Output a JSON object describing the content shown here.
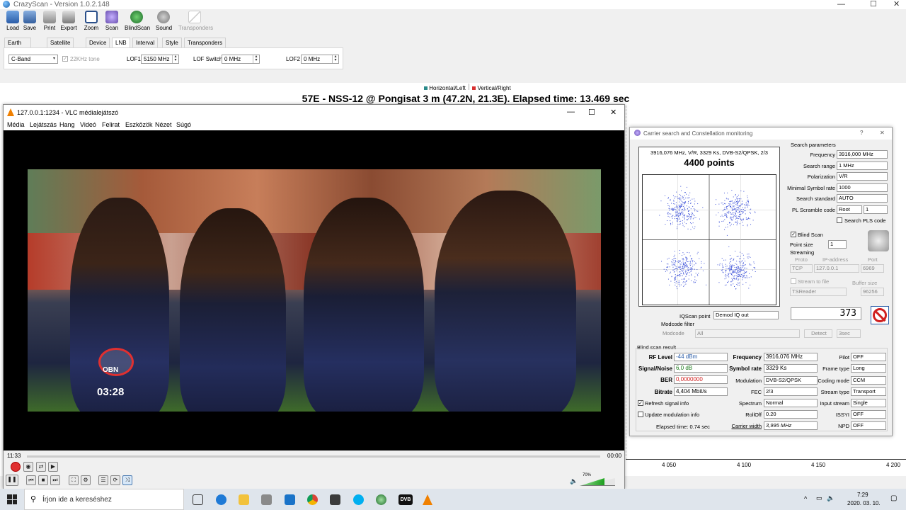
{
  "app": {
    "title": "CrazyScan - Version 1.0.2.148",
    "window_controls": {
      "minimize": "—",
      "maximize": "☐",
      "close": "✕"
    }
  },
  "toolbar": [
    {
      "label": "Load",
      "icon": "load-icon"
    },
    {
      "label": "Save",
      "icon": "save-icon"
    },
    {
      "label": "Print",
      "icon": "print-icon"
    },
    {
      "label": "Export",
      "icon": "export-icon"
    },
    {
      "label": "Zoom",
      "icon": "zoom-icon"
    },
    {
      "label": "Scan",
      "icon": "scan-icon"
    },
    {
      "label": "BlindScan",
      "icon": "blindscan-icon"
    },
    {
      "label": "Sound",
      "icon": "sound-icon"
    },
    {
      "label": "Transponders",
      "icon": "transponders-icon"
    }
  ],
  "tabs": [
    "Earth position",
    "Satellite info",
    "Device",
    "LNB",
    "Interval",
    "Style",
    "Transponders"
  ],
  "lnb": {
    "band": "C-Band",
    "tone_label": "22KHz tone",
    "lof1_label": "LOF1",
    "lof1": "5150 MHz",
    "lofswitch_label": "LOF Switch",
    "lofswitch": "0 MHz",
    "lof2_label": "LOF2",
    "lof2": "0 MHz"
  },
  "legend": {
    "h": "Horizontal/Left",
    "v": "Vertical/Right",
    "h_color": "#2a8a8a",
    "v_color": "#d83030"
  },
  "chart_title": "57E - NSS-12  @ Pongisat  3 m (47.2N, 21.3E). Elapsed time: 13.469 sec",
  "x_ticks": [
    "4 050",
    "4 100",
    "4 150",
    "4 200"
  ],
  "vlc": {
    "title": "127.0.0.1:1234 - VLC médialejátszó",
    "menu": [
      "Média",
      "Lejátszás",
      "Hang",
      "Videó",
      "Felirat",
      "Eszközök",
      "Nézet",
      "Súgó"
    ],
    "overlay_time": "03:28",
    "overlay_logo": "OBN",
    "time_elapsed": "11:33",
    "time_total": "00:00",
    "volume": "70%",
    "volume_fraction": 0.7
  },
  "dialog": {
    "title": "Carrier search and Constellation monitoring",
    "help": "?",
    "close": "✕",
    "constellation_info": "3916,076 MHz, V/R, 3329 Ks, DVB-S2/QPSK, 2/3",
    "points": "4400 points",
    "search_params_title": "Search parameters",
    "params": {
      "frequency_label": "Frequency",
      "frequency": "3916,000 MHz",
      "search_range_label": "Search range",
      "search_range": "1 MHz",
      "polarization_label": "Polarization",
      "polarization": "V/R",
      "min_sr_label": "Minimal Symbol rate",
      "min_sr": "1000",
      "search_std_label": "Search standard",
      "search_std": "AUTO",
      "pls_label": "PL Scramble code",
      "pls_mode": "Root",
      "pls_value": "1",
      "search_pls_label": "Search PLS code"
    },
    "blind_scan_label": "Blind Scan",
    "point_size_label": "Point size",
    "point_size": "1",
    "streaming": {
      "title": "Streaming",
      "proto_label": "Proto",
      "ip_label": "IP-address",
      "port_label": "Port",
      "proto": "TCP",
      "ip": "127.0.0.1",
      "port": "6969",
      "stream_file_label": "Stream to file",
      "buffer_label": "Buffer size",
      "reader": "TSReader",
      "buffer": "96256"
    },
    "iqscan_label": "IQScan point",
    "iqscan": "Demod IQ out",
    "modcode_filter": "Modcode filter",
    "modcode_label": "Modcode",
    "modcode": "All",
    "detect_label": "Detect",
    "detect_time": "3sec",
    "counter": "373",
    "result_title": "Blind scan result",
    "result": {
      "rf_label": "RF Level",
      "rf": "-44 dBm",
      "sn_label": "Signal/Noise",
      "sn": "6,0 dB",
      "ber_label": "BER",
      "ber": "0,0000000",
      "bitrate_label": "Bitrate",
      "bitrate": "4,404 Mbit/s",
      "freq_label": "Frequency",
      "freq": "3916,076 MHz",
      "sr_label": "Symbol rate",
      "sr": "3329 Ks",
      "mod_label": "Modulation",
      "mod": "DVB-S2/QPSK",
      "fec_label": "FEC",
      "fec": "2/3",
      "spectrum_label": "Spectrum",
      "spectrum": "Normal",
      "rolloff_label": "RollOff",
      "rolloff": "0.20",
      "cw_label": "Carrier width",
      "cw": "3,995 MHz",
      "pilot_label": "Pilot",
      "pilot": "OFF",
      "frame_label": "Frame type",
      "frame": "Long",
      "coding_label": "Coding mode",
      "coding": "CCM",
      "stype_label": "Stream type",
      "stype": "Transport",
      "istream_label": "Input stream",
      "istream": "Single",
      "issyi_label": "ISSYI",
      "issyi": "OFF",
      "npd_label": "NPD",
      "npd": "OFF"
    },
    "refresh_label": "Refresh signal info",
    "update_mod_label": "Update modulation info",
    "elapsed": "Elapsed time: 0.74 sec"
  },
  "taskbar": {
    "search_placeholder": "Írjon ide a kereséshez",
    "time": "7:29",
    "date": "2020. 03. 10.",
    "dvb_label": "DVB"
  }
}
